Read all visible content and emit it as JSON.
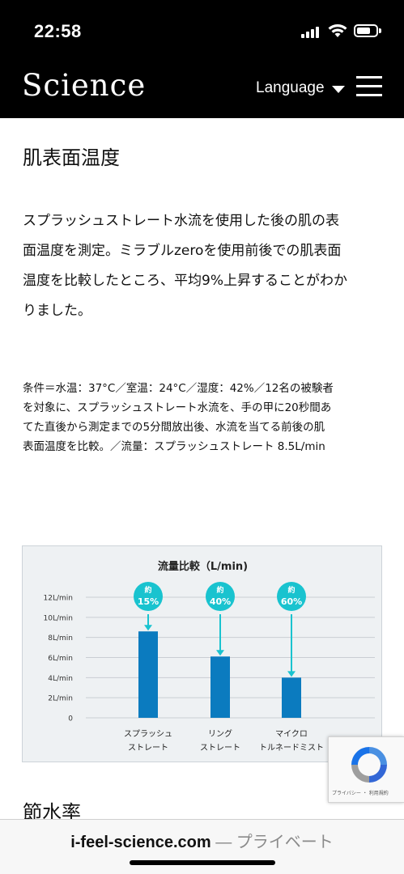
{
  "status_bar": {
    "time": "22:58",
    "icons": [
      "signal-icon",
      "wifi-icon",
      "battery-icon"
    ]
  },
  "header": {
    "logo": "Science",
    "language_label": "Language",
    "icons": [
      "caret-down-icon",
      "menu-icon"
    ]
  },
  "article": {
    "title": "肌表面温度",
    "lead_lines": [
      "スプラッシュストレート水流を使用した後の肌の表",
      "面温度を測定。ミラブルzeroを使用前後での肌表面",
      "温度を比較したところ、平均9%上昇することがわか",
      "りました。"
    ],
    "conditions_lines": [
      "条件＝水温：37°C／室温：24°C／湿度：42%／12名の被験者",
      "を対象に、スプラッシュストレート水流を、手の甲に20秒間あ",
      "てた直後から測定までの5分間放出後、水流を当てる前後の肌",
      "表面温度を比較。／流量：スプラッシュストレート 8.5L/min"
    ],
    "next_heading": "節水率"
  },
  "chart_data": {
    "type": "bar",
    "title": "流量比較（L/min)",
    "categories": [
      [
        "スプラッシュ",
        "ストレート"
      ],
      [
        "リング",
        "ストレート"
      ],
      [
        "マイクロ",
        "トルネードミスト"
      ]
    ],
    "values": [
      8.6,
      6.1,
      4.0
    ],
    "ylim": [
      0,
      12
    ],
    "yticks": [
      0,
      2,
      4,
      6,
      8,
      10,
      12
    ],
    "ytick_labels": [
      "0",
      "2L/min",
      "4L/min",
      "6L/min",
      "8L/min",
      "10L/min",
      "12L/min"
    ],
    "annotations": [
      {
        "top": "約",
        "bottom": "15%"
      },
      {
        "top": "約",
        "bottom": "40%"
      },
      {
        "top": "約",
        "bottom": "60%"
      }
    ],
    "grid": true,
    "colors": {
      "bar": "#0b7bbf",
      "badge": "#19c3cf",
      "arrow": "#19c3cf",
      "grid": "#c9ced3",
      "background": "#eef1f3"
    }
  },
  "recaptcha": {
    "text": "プライバシー ・ 利用規約",
    "icon": "recaptcha-icon"
  },
  "url_bar": {
    "domain": "i-feel-science.com",
    "separator": " — ",
    "suffix": "プライベート"
  }
}
